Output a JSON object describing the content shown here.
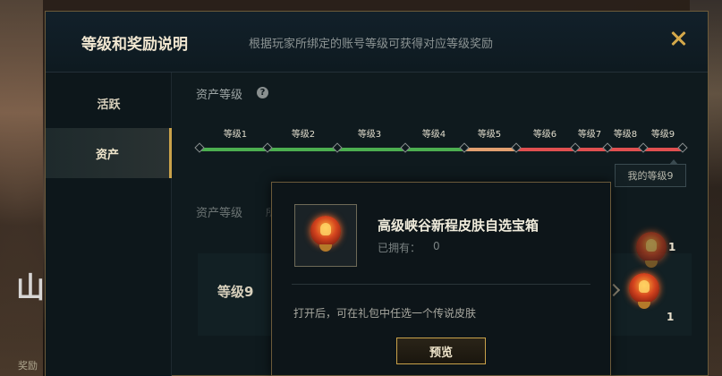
{
  "background": {
    "glyph": "山",
    "small_text": "奖励"
  },
  "dialog": {
    "title": "等级和奖励说明",
    "subtitle": "根据玩家所绑定的账号等级可获得对应等级奖励"
  },
  "sidebar": {
    "items": [
      {
        "label": "活跃",
        "active": false
      },
      {
        "label": "资产",
        "active": true
      }
    ]
  },
  "content": {
    "section_title": "资产等级",
    "levels": [
      "等级1",
      "等级2",
      "等级3",
      "等级4",
      "等级5",
      "等级6",
      "等级7",
      "等级8",
      "等级9"
    ],
    "segment_colors": [
      "#4caf50",
      "#4caf50",
      "#4caf50",
      "#4caf50",
      "#e2a070",
      "#e05050",
      "#e05050",
      "#e05050",
      "#e05050"
    ],
    "my_level": "我的等级9",
    "section_title_2": "资产等级",
    "section_title_2_more": "所",
    "row_level": "等级9",
    "reward_count": "1",
    "reward_count_top": "1"
  },
  "popup": {
    "title": "高级峡谷新程皮肤自选宝箱",
    "owned_label": "已拥有：",
    "owned_value": "0",
    "description": "打开后，可在礼包中任选一个传说皮肤",
    "preview_button": "预览"
  },
  "colors": {
    "accent_gold": "#c9a24a"
  }
}
